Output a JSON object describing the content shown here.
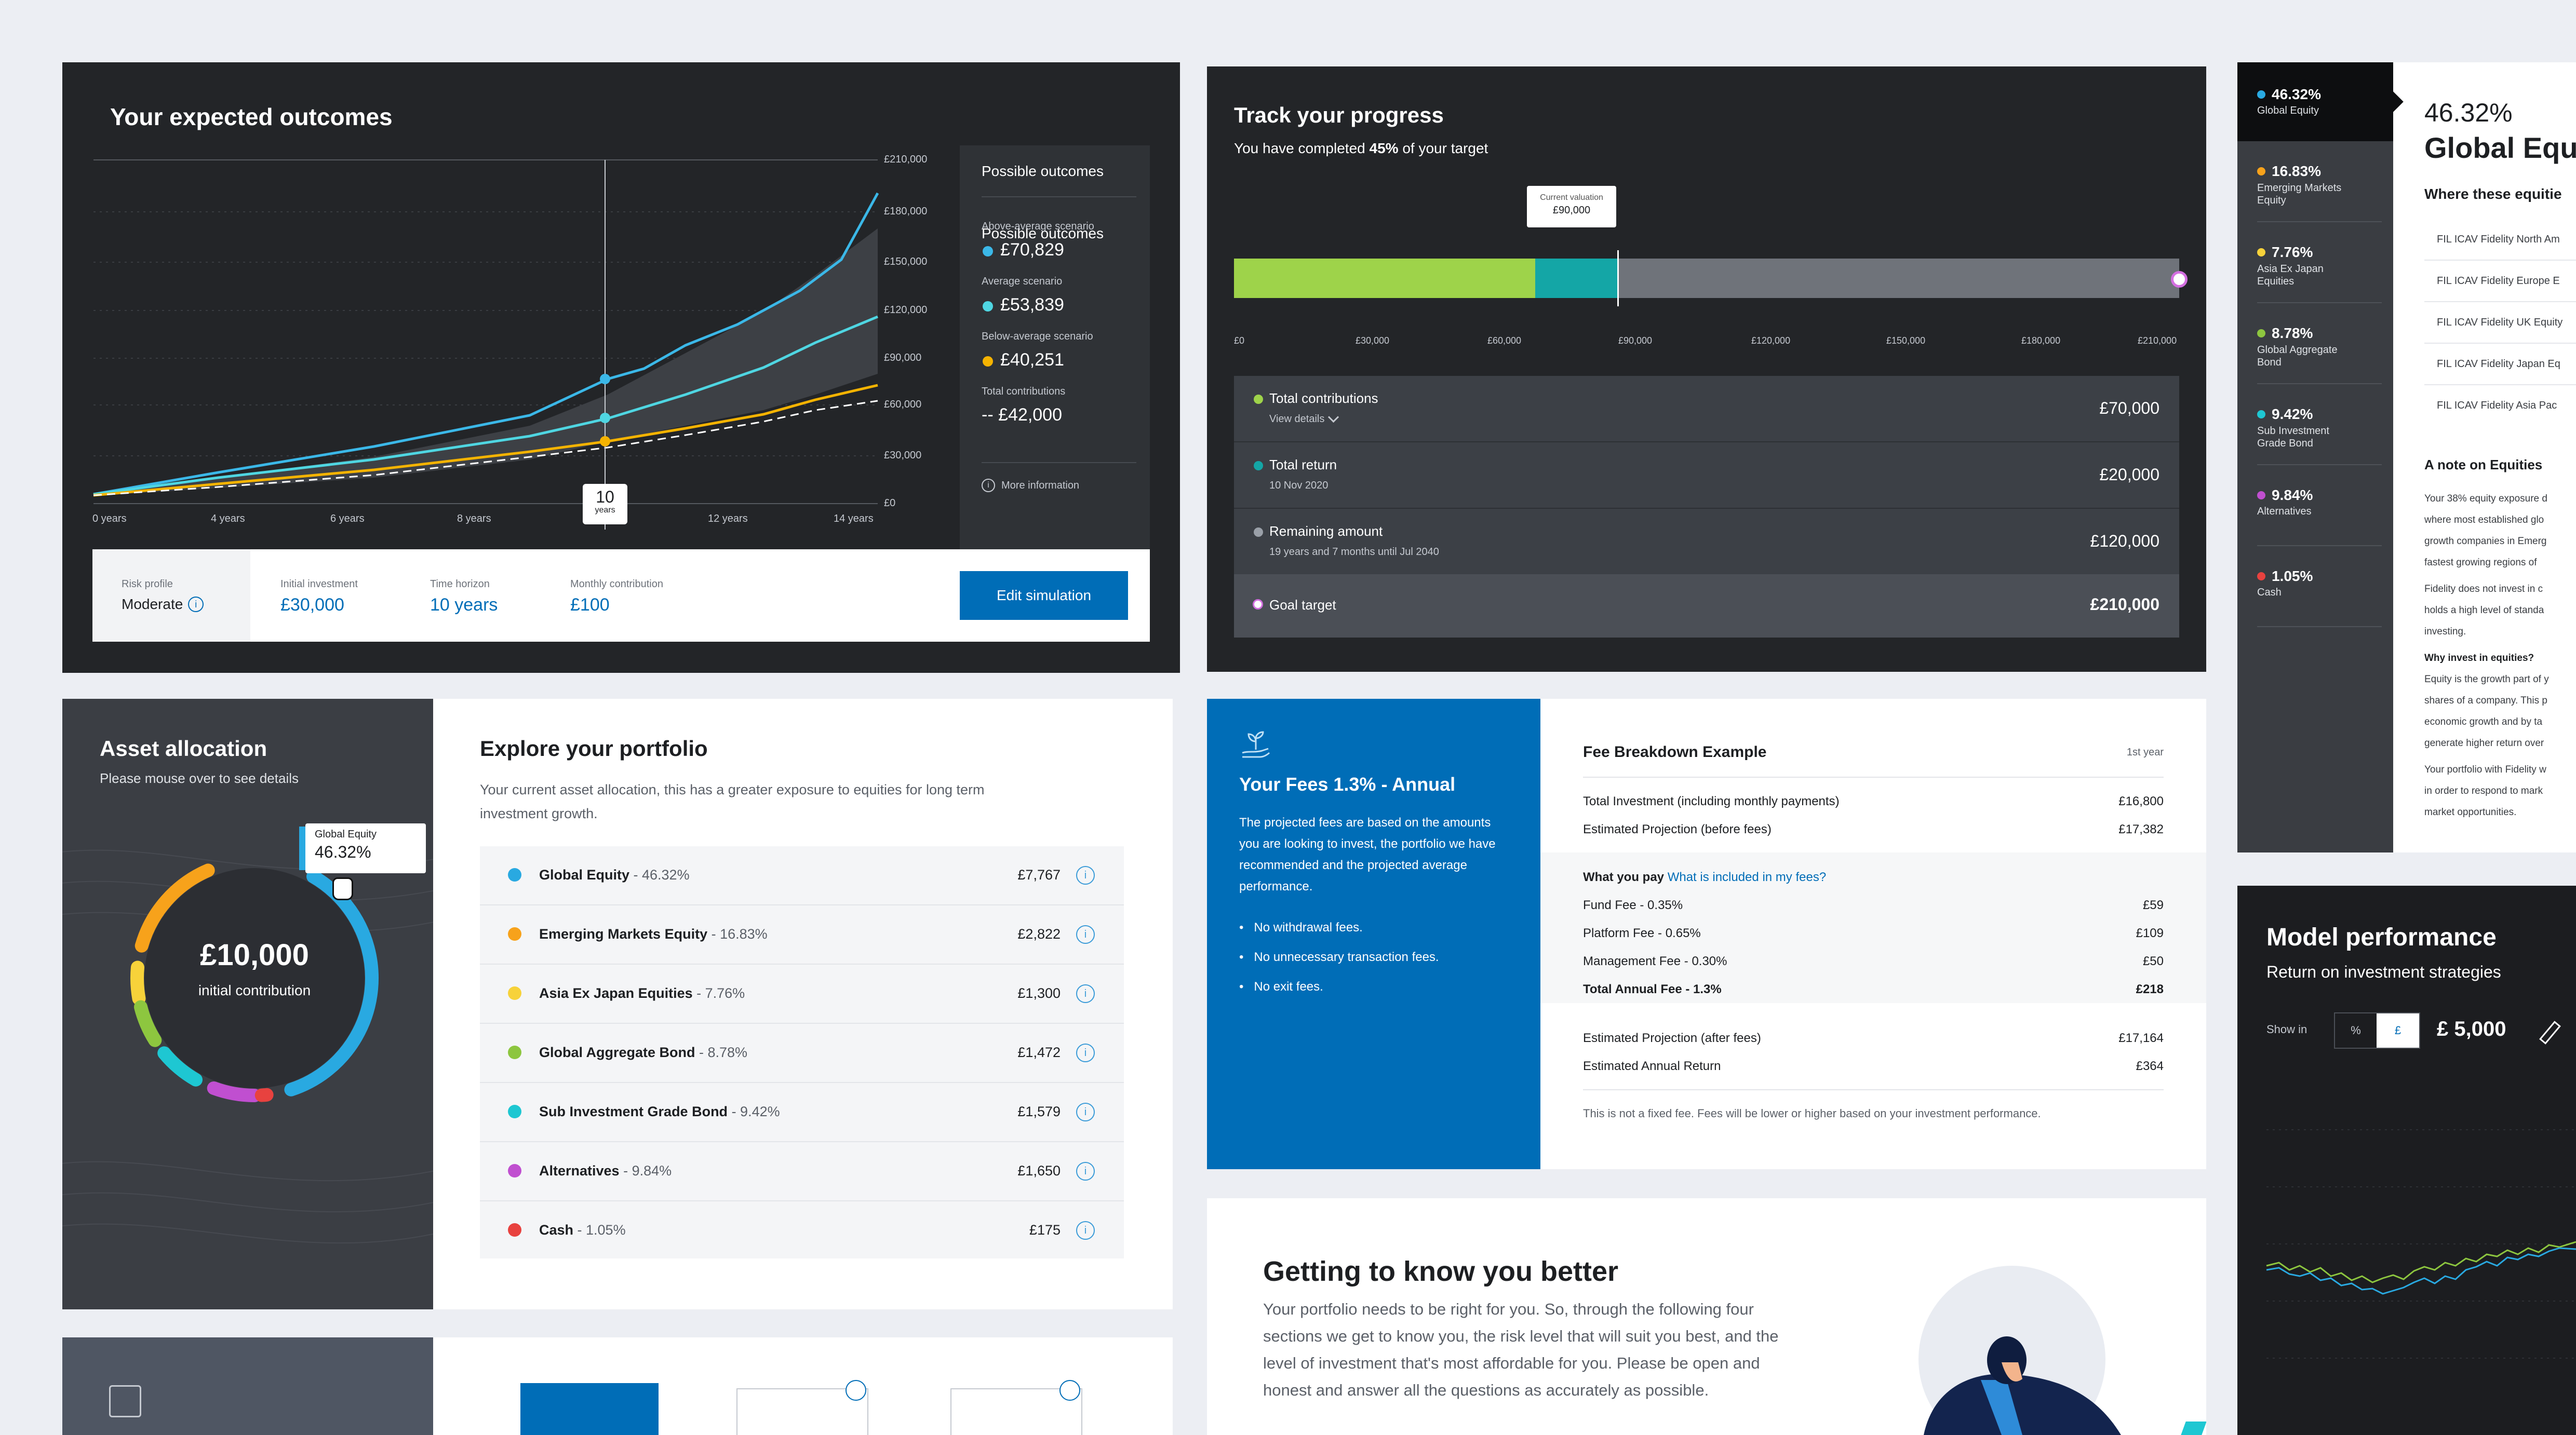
{
  "outcomes": {
    "title": "Your expected outcomes",
    "y_ticks": [
      "£210,000",
      "£180,000",
      "£150,000",
      "£120,000",
      "£90,000",
      "£60,000",
      "£30,000",
      "£0"
    ],
    "x_ticks": [
      "0 years",
      "4 years",
      "6 years",
      "8 years",
      "12 years",
      "14 years"
    ],
    "marker_value": "10",
    "marker_unit": "years",
    "possible": {
      "title": "Possible outcomes",
      "items": [
        {
          "label": "Above-average scenario",
          "value": "£70,829",
          "color": "#3bb8e8"
        },
        {
          "label": "Average scenario",
          "value": "£53,839",
          "color": "#4fd6e2"
        },
        {
          "label": "Below-average scenario",
          "value": "£40,251",
          "color": "#f5b301"
        },
        {
          "label": "Total contributions",
          "value": "-- £42,000",
          "color": "#ffffff"
        }
      ],
      "more_info": "More information"
    },
    "bar": {
      "risk_label": "Risk profile",
      "risk_value": "Moderate",
      "initial_label": "Initial investment",
      "initial_value": "£30,000",
      "horizon_label": "Time horizon",
      "horizon_value": "10 years",
      "monthly_label": "Monthly contribution",
      "monthly_value": "£100",
      "edit_button": "Edit simulation"
    }
  },
  "track": {
    "title": "Track your progress",
    "subtitle_pre": "You have completed ",
    "subtitle_pct": "45%",
    "subtitle_post": " of your target",
    "tooltip_label": "Current valuation",
    "tooltip_value": "£90,000",
    "axis": [
      "£0",
      "£30,000",
      "£60,000",
      "£90,000",
      "£120,000",
      "£150,000",
      "£180,000",
      "£210,000"
    ],
    "rows": [
      {
        "label": "Total contributions",
        "sub": "View details",
        "value": "£70,000",
        "color": "#9ed34a"
      },
      {
        "label": "Total return",
        "sub": "10 Nov 2020",
        "value": "£20,000",
        "color": "#14a6a6"
      },
      {
        "label": "Remaining amount",
        "sub": "19 years and 7 months until Jul 2040",
        "value": "£120,000",
        "color": "#9aa0a8"
      },
      {
        "label": "Goal target",
        "sub": "",
        "value": "£210,000",
        "color": "#ffffff"
      }
    ]
  },
  "allocation_side": {
    "items": [
      {
        "pct": "46.32%",
        "name": "Global Equity",
        "color": "#29a9e1"
      },
      {
        "pct": "16.83%",
        "name": "Emerging Markets Equity",
        "color": "#f7a21b"
      },
      {
        "pct": "7.76%",
        "name": "Asia Ex Japan Equities",
        "color": "#f7d23a"
      },
      {
        "pct": "8.78%",
        "name": "Global Aggregate Bond",
        "color": "#8dc63f"
      },
      {
        "pct": "9.42%",
        "name": "Sub Investment Grade Bond",
        "color": "#1ec7d2"
      },
      {
        "pct": "9.84%",
        "name": "Alternatives",
        "color": "#c04fd0"
      },
      {
        "pct": "1.05%",
        "name": "Cash",
        "color": "#e8423f"
      }
    ],
    "detail_pct": "46.32%",
    "detail_title": "Global Equi",
    "where_title": "Where these equitie",
    "funds": [
      "FIL ICAV Fidelity North Am",
      "FIL ICAV Fidelity Europe E",
      "FIL ICAV Fidelity UK Equity",
      "FIL ICAV Fidelity Japan Eq",
      "FIL ICAV Fidelity Asia Pac"
    ],
    "note_title": "A note on Equities",
    "note_lines": [
      "Your 38% equity exposure d",
      "where most established glo",
      "growth companies in Emerg",
      "fastest growing regions of"
    ],
    "note2_lines": [
      "Fidelity does not invest in c",
      "holds a high level of standa",
      "investing."
    ],
    "why_title": "Why invest in equities?",
    "why_lines": [
      "Equity is the growth part of y",
      "shares of a company. This p",
      "economic growth and by ta",
      "generate higher return over"
    ],
    "port_lines": [
      "Your portfolio with Fidelity w",
      "in order to respond to mark",
      "market opportunities."
    ]
  },
  "asset": {
    "title": "Asset allocation",
    "subtitle": "Please mouse over to see details",
    "center_value": "£10,000",
    "center_label": "initial contribution",
    "tooltip_name": "Global Equity",
    "tooltip_pct": "46.32%"
  },
  "explore": {
    "title": "Explore your portfolio",
    "desc": "Your current asset allocation, this has a greater exposure to equities for long term investment growth.",
    "rows": [
      {
        "name": "Global Equity",
        "pct": " - 46.32%",
        "value": "£7,767",
        "color": "#29a9e1"
      },
      {
        "name": "Emerging Markets Equity",
        "pct": " - 16.83%",
        "value": "£2,822",
        "color": "#f7a21b"
      },
      {
        "name": "Asia Ex Japan Equities",
        "pct": " - 7.76%",
        "value": "£1,300",
        "color": "#f7d23a"
      },
      {
        "name": "Global Aggregate Bond",
        "pct": " - 8.78%",
        "value": "£1,472",
        "color": "#8dc63f"
      },
      {
        "name": "Sub Investment Grade Bond",
        "pct": " - 9.42%",
        "value": "£1,579",
        "color": "#1ec7d2"
      },
      {
        "name": "Alternatives",
        "pct": " - 9.84%",
        "value": "£1,650",
        "color": "#c04fd0"
      },
      {
        "name": "Cash",
        "pct": " - 1.05%",
        "value": "£175",
        "color": "#e8423f"
      }
    ]
  },
  "fees": {
    "title": "Your Fees 1.3% - Annual",
    "desc": "The projected fees are based on the amounts you are looking to invest, the portfolio we have recommended and the projected average performance.",
    "bullets": [
      "No withdrawal fees.",
      "No unnecessary transaction fees.",
      "No exit fees."
    ]
  },
  "fee_breakdown": {
    "title": "Fee Breakdown Example",
    "period": "1st year",
    "rows1": [
      {
        "label": "Total Investment (including monthly payments)",
        "value": "£16,800"
      },
      {
        "label": "Estimated Projection (before fees)",
        "value": "£17,382"
      }
    ],
    "what_pay": "What you pay",
    "what_link": "What is included in my fees?",
    "rows2": [
      {
        "label": "Fund Fee - 0.35%",
        "value": "£59"
      },
      {
        "label": "Platform Fee - 0.65%",
        "value": "£109"
      },
      {
        "label": "Management Fee - 0.30%",
        "value": "£50"
      },
      {
        "label": "Total Annual Fee - 1.3%",
        "value": "£218"
      }
    ],
    "rows3": [
      {
        "label": "Estimated Projection (after fees)",
        "value": "£17,164"
      },
      {
        "label": "Estimated Annual Return",
        "value": "£364"
      }
    ],
    "footnote": "This is not a fixed fee. Fees will be lower or higher based on your investment performance."
  },
  "know": {
    "title": "Getting to know you better",
    "text": "Your portfolio needs to be right for you. So, through the following four sections we get to know you, the risk level that will suit you best, and the level of investment that's most affordable for you. Please be open and honest and answer all the questions as accurately as possible."
  },
  "model": {
    "title": "Model performance",
    "subtitle": "Return on investment strategies",
    "show_in": "Show in",
    "opt_pct": "%",
    "opt_gbp": "£",
    "amount": "£ 5,000"
  }
}
